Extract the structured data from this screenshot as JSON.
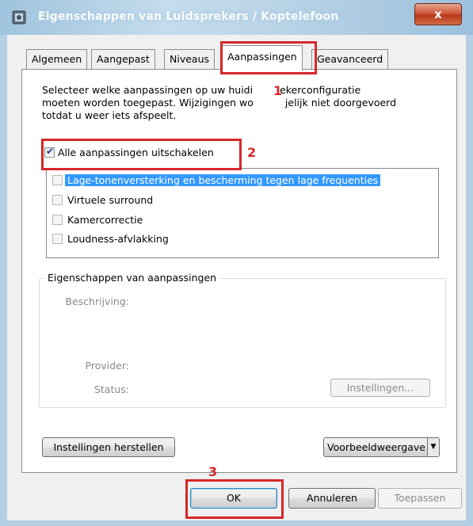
{
  "window": {
    "title": "Eigenschappen van Luidsprekers / Koptelefoon",
    "close_label": "x"
  },
  "tabs": [
    {
      "label": "Algemeen",
      "active": false
    },
    {
      "label": "Aangepast",
      "active": false
    },
    {
      "label": "Niveaus",
      "active": false
    },
    {
      "label": "Aanpassingen",
      "active": true
    },
    {
      "label": "Geavanceerd",
      "active": false
    }
  ],
  "intro": {
    "line1_a": "Selecteer welke aanpassingen op uw huidi",
    "line1_b": "ekerconfiguratie",
    "line2_a": "moeten worden toegepast. Wijzigingen wo",
    "line2_b": "jelijk niet doorgevoerd",
    "line3": "totdat u weer iets afspeelt."
  },
  "master_checkbox": {
    "label": "Alle aanpassingen uitschakelen",
    "checked": true
  },
  "enhancements": [
    {
      "label": "Lage-tonenversterking en bescherming tegen lage frequenties",
      "selected": true
    },
    {
      "label": "Virtuele surround",
      "selected": false
    },
    {
      "label": "Kamercorrectie",
      "selected": false
    },
    {
      "label": "Loudness-afvlakking",
      "selected": false
    }
  ],
  "properties": {
    "group_title": "Eigenschappen van aanpassingen",
    "description_label": "Beschrijving:",
    "provider_label": "Provider:",
    "status_label": "Status:",
    "settings_button": "Instellingen..."
  },
  "buttons": {
    "restore": "Instellingen herstellen",
    "preview": "Voorbeeldweergave",
    "ok": "OK",
    "cancel": "Annuleren",
    "apply": "Toepassen"
  },
  "annotations": {
    "n1": "1",
    "n2": "2",
    "n3": "3"
  },
  "colors": {
    "annotation": "#d6282a",
    "selection": "#3399ff"
  }
}
